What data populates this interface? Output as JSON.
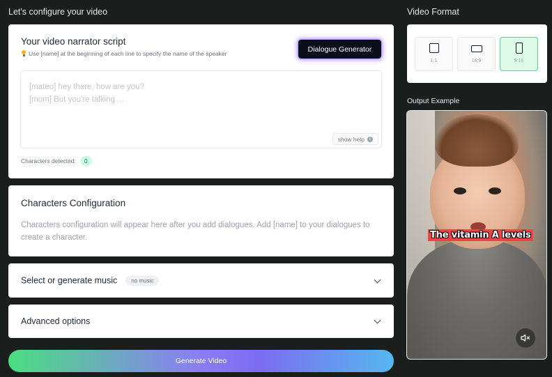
{
  "header": {
    "configure_title": "Let's configure your video",
    "format_title": "Video Format",
    "output_title": "Output Example"
  },
  "script": {
    "heading": "Your video narrator script",
    "hint": "Use [name] at the beginning of each line to specify the name of the speaker",
    "dialogue_button": "Dialogue Generator",
    "placeholder_line1": "[mateo] hey there, how are you?",
    "placeholder_line2": "[mom] But you're talking ...",
    "show_help": "show help",
    "characters_detected_label": "Characters detected:",
    "characters_detected_count": "0"
  },
  "characters": {
    "heading": "Characters Configuration",
    "description": "Characters configuration will appear here after you add dialogues. Add [name] to your dialogues to create a character."
  },
  "music": {
    "label": "Select or generate music",
    "badge": "no music"
  },
  "advanced": {
    "label": "Advanced options"
  },
  "generate_button": "Generate Video",
  "formats": [
    {
      "label": "1:1",
      "selected": false
    },
    {
      "label": "16:9",
      "selected": false
    },
    {
      "label": "9:16",
      "selected": true
    }
  ],
  "output": {
    "caption": "The vitamin A levels"
  },
  "colors": {
    "background": "#1a1f1e",
    "selected_format": "#dcfce7",
    "caption_highlight": "#ef4444"
  }
}
